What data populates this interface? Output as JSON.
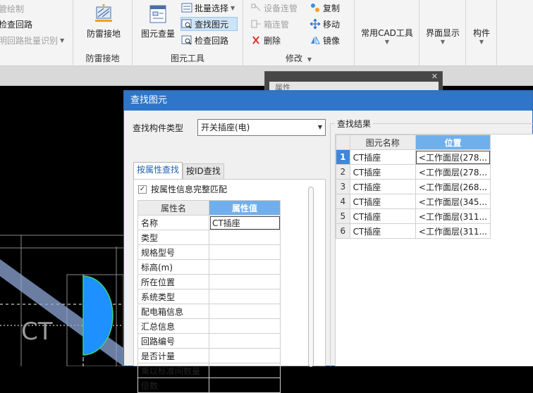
{
  "ribbon": {
    "left_items": [
      {
        "label": "管绘制",
        "disabled": true
      },
      {
        "label": "检查回路",
        "disabled": false
      },
      {
        "label": "明回路批量识别",
        "disabled": true
      }
    ],
    "lightning": {
      "button": "防雷接地",
      "caption": "防雷接地"
    },
    "element_tools": {
      "big_button": "图元查量",
      "batch_select": "批量选择",
      "find_element": "查找图元",
      "check_loop": "检查回路",
      "caption": "图元工具"
    },
    "modify": {
      "device_pipe": "设备连管",
      "box_pipe": "箱连管",
      "delete": "删除",
      "copy": "复制",
      "move": "移动",
      "mirror": "镜像",
      "caption": "修改"
    },
    "menus": [
      {
        "label": "常用CAD工具"
      },
      {
        "label": "界面显示"
      },
      {
        "label": "构件"
      }
    ]
  },
  "bg_window": {
    "title": "属性"
  },
  "dialog": {
    "title": "查找图元",
    "type_label": "查找构件类型",
    "type_value": "开关插座(电)",
    "tabs": [
      "按属性查找",
      "按ID查找"
    ],
    "match_checkbox": {
      "label": "按属性信息完整匹配",
      "checked": true
    },
    "prop_table": {
      "headers": [
        "属性名",
        "属性值"
      ],
      "rows": [
        [
          "名称",
          "CT插座"
        ],
        [
          "类型",
          ""
        ],
        [
          "规格型号",
          ""
        ],
        [
          "标高(m)",
          ""
        ],
        [
          "所在位置",
          ""
        ],
        [
          "系统类型",
          ""
        ],
        [
          "配电箱信息",
          ""
        ],
        [
          "汇总信息",
          ""
        ],
        [
          "回路编号",
          ""
        ],
        [
          "是否计量",
          ""
        ],
        [
          "乘以标准间数量",
          ""
        ],
        [
          "倍数",
          ""
        ]
      ]
    },
    "results": {
      "group_label": "查找结果",
      "headers": [
        "图元名称",
        "位置"
      ],
      "rows": [
        {
          "num": "1",
          "name": "CT插座",
          "pos": "<工作面层(278..."
        },
        {
          "num": "2",
          "name": "CT插座",
          "pos": "<工作面层(278..."
        },
        {
          "num": "3",
          "name": "CT插座",
          "pos": "<工作面层(268..."
        },
        {
          "num": "4",
          "name": "CT插座",
          "pos": "<工作面层(345..."
        },
        {
          "num": "5",
          "name": "CT插座",
          "pos": "<工作面层(311..."
        },
        {
          "num": "6",
          "name": "CT插座",
          "pos": "<工作面层(311..."
        }
      ]
    }
  },
  "colors": {
    "title_bar": "#2f75c9",
    "selected_header": "#6fb0ec",
    "cad_shape": "#1e90ff"
  }
}
